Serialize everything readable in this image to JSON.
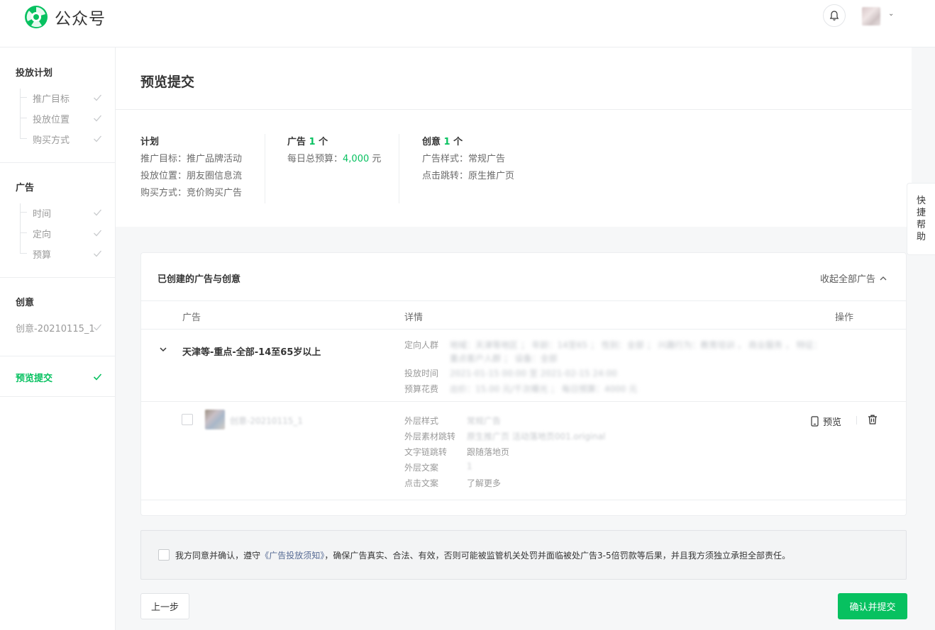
{
  "app": {
    "brand": "公众号",
    "colors": {
      "accent": "#07c160",
      "link": "#576b95"
    }
  },
  "sidebar": {
    "groups": [
      {
        "title": "投放计划",
        "items": [
          "推广目标",
          "投放位置",
          "购买方式"
        ]
      },
      {
        "title": "广告",
        "items": [
          "时间",
          "定向",
          "预算"
        ]
      },
      {
        "title": "创意",
        "items": [
          "创意-20210115_1"
        ]
      }
    ],
    "active": "预览提交"
  },
  "page": {
    "title": "预览提交"
  },
  "summary": {
    "plan": {
      "title": "计划",
      "lines": [
        "推广目标：推广品牌活动",
        "投放位置：朋友圈信息流",
        "购买方式：竞价购买广告"
      ]
    },
    "ad": {
      "title_prefix": "广告",
      "count": "1",
      "unit": "个",
      "budget_label": "每日总预算：",
      "budget_value": "4,000",
      "budget_unit": "元"
    },
    "creative": {
      "title_prefix": "创意",
      "count": "1",
      "unit": "个",
      "lines": [
        "广告样式：常规广告",
        "点击跳转：原生推广页"
      ]
    }
  },
  "help": {
    "chars": [
      "快",
      "捷",
      "帮",
      "助"
    ]
  },
  "card": {
    "title": "已创建的广告与创意",
    "collapse_label": "收起全部广告",
    "columns": {
      "ad": "广告",
      "detail": "详情",
      "ops": "操作"
    },
    "ad_row": {
      "name": "天津等-重点-全部-14至65岁以上",
      "audience_label": "定向人群",
      "audience_line1": "地域：天津等地区 ；  年龄：14至65 ；  性别：全部 ；  兴趣行为：教育培训 ，  商业服务 ，  特征：",
      "audience_line2": "重点客户人群 ；  设备：全部",
      "time_label": "投放时间",
      "time_value": "2021-01-15 00:00 至 2021-02-15 24:00",
      "cost_label": "预算花费",
      "cost_value": "出价：15.00 元/千次曝光 ；  每日预算：4000 元"
    },
    "creative_row": {
      "name": "创意-20210115_1",
      "style_label": "外层样式",
      "style_value": "常规广告",
      "jump_label": "外层素材跳转",
      "jump_value": "原生推广页 活动落地页001.original",
      "textlink_label": "文字链跳转",
      "textlink_value": "跟随落地页",
      "copy_label": "外层文案",
      "copy_value": "1",
      "click_label": "点击文案",
      "click_value": "了解更多",
      "preview_label": "预览"
    }
  },
  "agreement": {
    "before": "我方同意并确认，遵守",
    "link": "《广告投放须知》",
    "after": "，确保广告真实、合法、有效，否则可能被监管机关处罚并面临被处广告3-5倍罚款等后果，并且我方须独立承担全部责任。"
  },
  "actions": {
    "prev": "上一步",
    "submit": "确认并提交"
  }
}
